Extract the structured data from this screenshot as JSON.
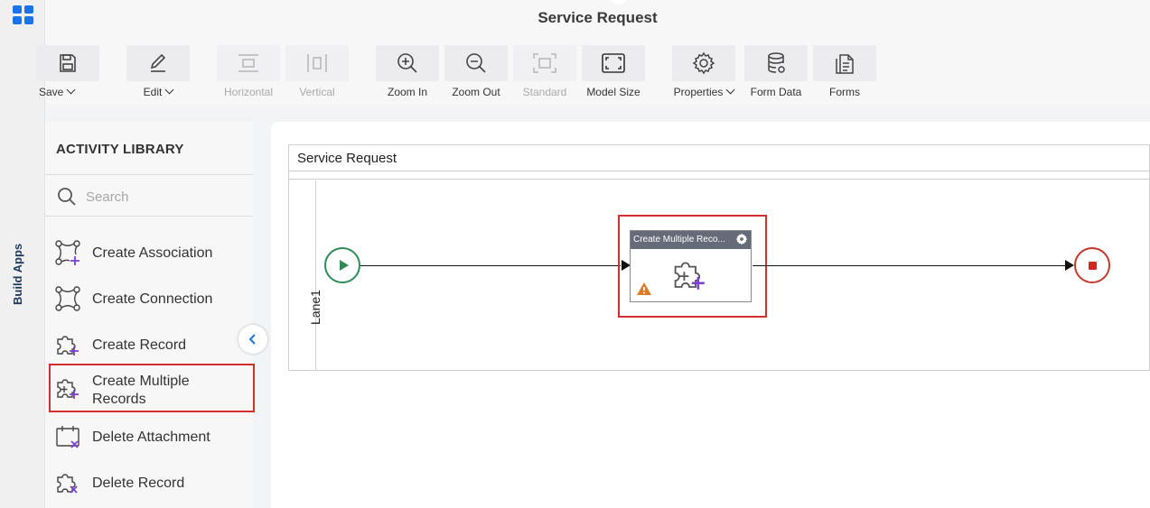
{
  "header": {
    "title": "Service Request"
  },
  "left_strip": {
    "label": "Build Apps",
    "apps_icon": "apps-grid-icon",
    "accent": "#1a73e8"
  },
  "toolbar": {
    "save_label": "Save",
    "edit_label": "Edit",
    "horizontal_label": "Horizontal",
    "vertical_label": "Vertical",
    "zoom_in_label": "Zoom In",
    "zoom_out_label": "Zoom Out",
    "standard_label": "Standard",
    "model_size_label": "Model Size",
    "properties_label": "Properties",
    "form_data_label": "Form Data",
    "forms_label": "Forms"
  },
  "library": {
    "title": "ACTIVITY LIBRARY",
    "search_placeholder": "Search",
    "items": [
      {
        "label": "Create Association",
        "icon": "association-icon"
      },
      {
        "label": "Create Connection",
        "icon": "connection-icon"
      },
      {
        "label": "Create Record",
        "icon": "puzzle-plus-icon"
      },
      {
        "label": "Create Multiple Records",
        "label_line1": "Create Multiple",
        "label_line2": "Records",
        "icon": "puzzle-multi-plus-icon",
        "highlighted": true
      },
      {
        "label": "Delete Attachment",
        "icon": "attachment-delete-icon"
      },
      {
        "label": "Delete Record",
        "icon": "puzzle-delete-icon"
      }
    ]
  },
  "canvas": {
    "pool_title": "Service Request",
    "lane_label": "Lane1",
    "task_title": "Create Multiple Reco...",
    "start_color": "#2e8b57",
    "end_color": "#c0392b",
    "highlight_color": "#d32f2f"
  }
}
